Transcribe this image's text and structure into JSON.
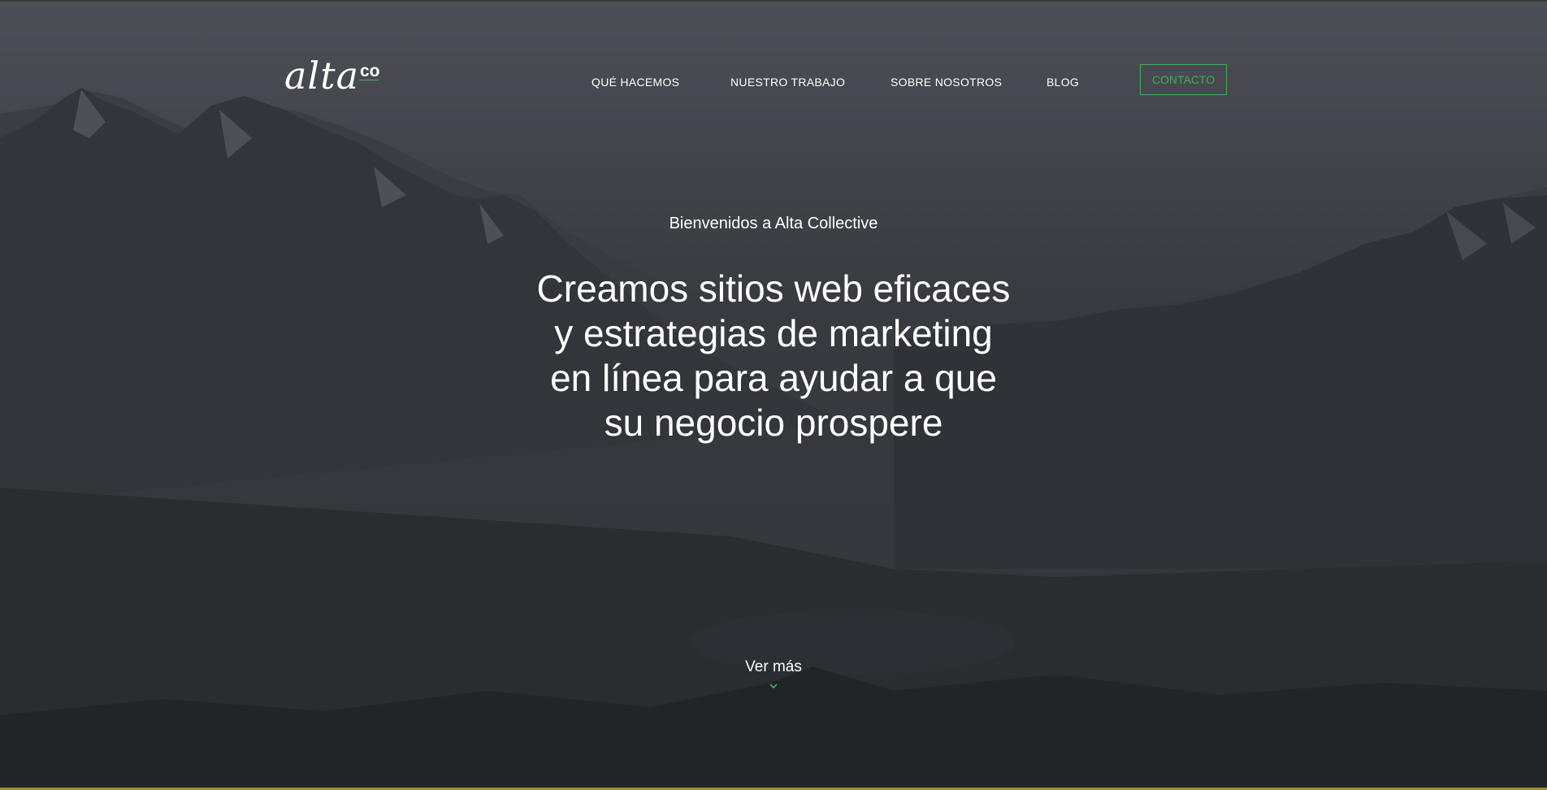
{
  "header": {
    "logo_text": "alta",
    "logo_suffix": "co"
  },
  "nav": {
    "items": [
      {
        "label": "QUÉ HACEMOS"
      },
      {
        "label": "NUESTRO TRABAJO"
      },
      {
        "label": "SOBRE NOSOTROS"
      },
      {
        "label": "BLOG"
      }
    ],
    "contact_label": "CONTACTO"
  },
  "hero": {
    "welcome": "Bienvenidos a Alta Collective",
    "headline_lines": [
      "Creamos sitios web eficaces",
      "y estrategias de marketing",
      "en línea para ayudar a que",
      "su negocio prospere"
    ],
    "more_label": "Ver más"
  },
  "icons": {
    "scroll": "chevron-down-icon"
  },
  "colors": {
    "accent": "#3fae5c",
    "text": "#ffffff",
    "background": "#2c2d31"
  }
}
